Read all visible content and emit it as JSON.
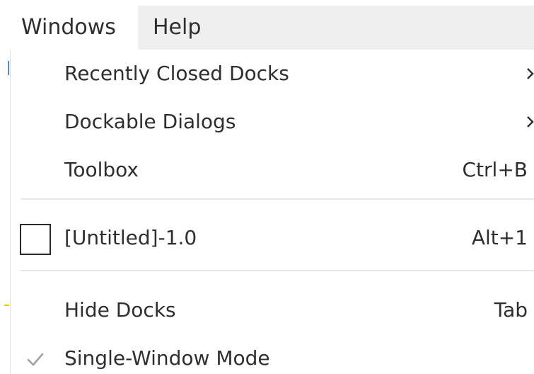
{
  "menubar": {
    "items": [
      {
        "label": "Windows"
      },
      {
        "label": "Help"
      }
    ]
  },
  "dropdown": {
    "recently_closed_docks": {
      "label": "Recently Closed Docks",
      "submenu_icon": "chevron-right-icon"
    },
    "dockable_dialogs": {
      "label": "Dockable Dialogs",
      "submenu_icon": "chevron-right-icon"
    },
    "toolbox": {
      "label": "Toolbox",
      "shortcut": "Ctrl+B"
    },
    "image_untitled": {
      "label": "[Untitled]-1.0",
      "shortcut": "Alt+1",
      "checked": false
    },
    "hide_docks": {
      "label": "Hide Docks",
      "shortcut": "Tab"
    },
    "single_window_mode": {
      "label": "Single-Window Mode",
      "checked": true
    }
  },
  "colors": {
    "menubar_bg": "#efefef",
    "active_menu_bg": "#ffffff",
    "text": "#2e2e2e",
    "separator": "#e6e6e6",
    "checkmark": "#a0a0a0"
  }
}
